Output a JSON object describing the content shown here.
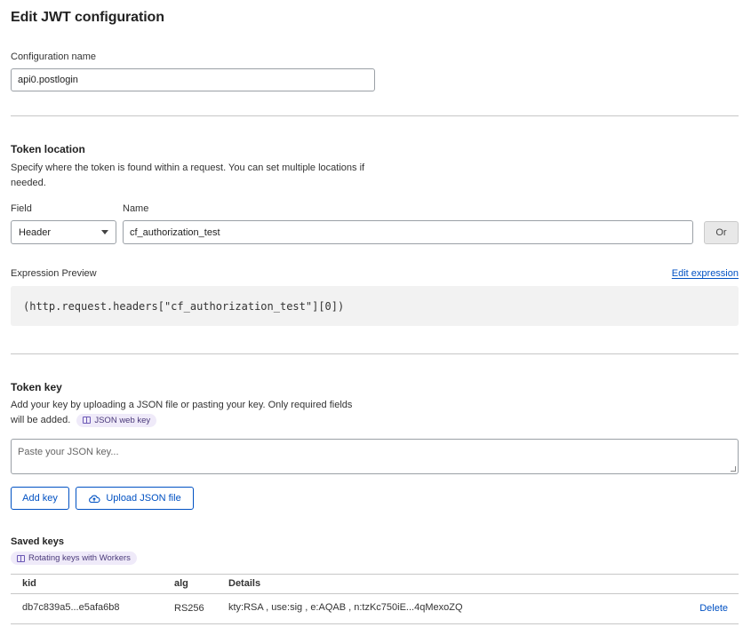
{
  "page": {
    "title": "Edit JWT configuration"
  },
  "config": {
    "label": "Configuration name",
    "value": "api0.postlogin"
  },
  "token_location": {
    "title": "Token location",
    "description": "Specify where the token is found within a request. You can set multiple locations if needed.",
    "field_label": "Field",
    "name_label": "Name",
    "field_value": "Header",
    "name_value": "cf_authorization_test",
    "or_label": "Or",
    "expression_label": "Expression Preview",
    "edit_expression": "Edit expression",
    "expression": "(http.request.headers[\"cf_authorization_test\"][0])"
  },
  "token_key": {
    "title": "Token key",
    "description": "Add your key by uploading a JSON file or pasting your key. Only required fields will be added.",
    "pill": "JSON web key",
    "placeholder": "Paste your JSON key...",
    "add_key": "Add key",
    "upload": "Upload JSON file"
  },
  "saved_keys": {
    "title": "Saved keys",
    "pill": "Rotating keys with Workers",
    "columns": [
      "kid",
      "alg",
      "Details"
    ],
    "rows": [
      {
        "kid": "db7c839a5...e5afa6b8",
        "alg": "RS256",
        "details": "kty:RSA , use:sig , e:AQAB , n:tzKc750iE...4qMexoZQ",
        "action": "Delete"
      }
    ]
  },
  "colors": {
    "accent": "#0051c3",
    "pill_bg": "#efeaf9",
    "code_bg": "#f2f2f2"
  }
}
